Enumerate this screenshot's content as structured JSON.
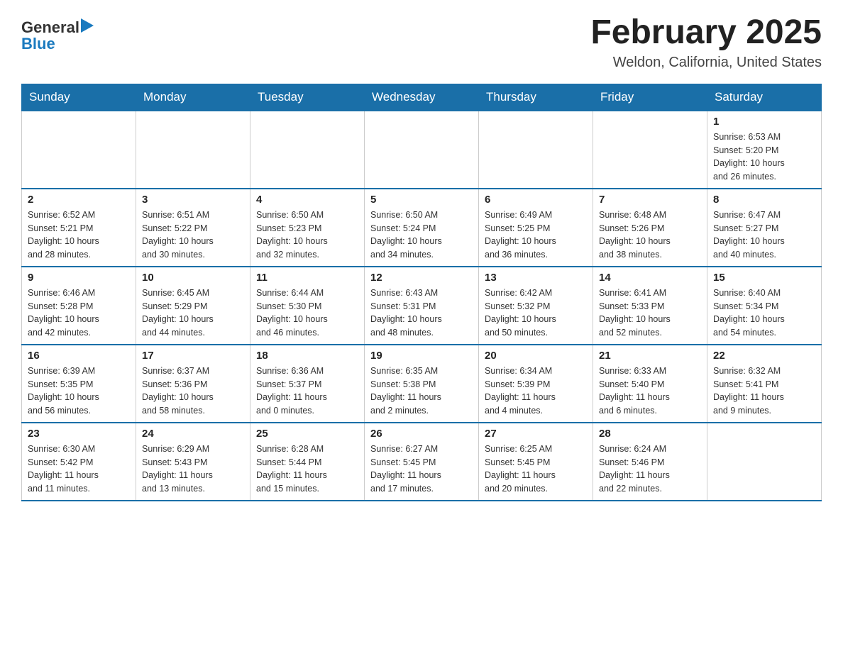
{
  "header": {
    "logo_general": "General",
    "logo_blue": "Blue",
    "month_title": "February 2025",
    "location": "Weldon, California, United States"
  },
  "days_of_week": [
    "Sunday",
    "Monday",
    "Tuesday",
    "Wednesday",
    "Thursday",
    "Friday",
    "Saturday"
  ],
  "weeks": [
    [
      {
        "day": "",
        "info": "",
        "empty": true
      },
      {
        "day": "",
        "info": "",
        "empty": true
      },
      {
        "day": "",
        "info": "",
        "empty": true
      },
      {
        "day": "",
        "info": "",
        "empty": true
      },
      {
        "day": "",
        "info": "",
        "empty": true
      },
      {
        "day": "",
        "info": "",
        "empty": true
      },
      {
        "day": "1",
        "info": "Sunrise: 6:53 AM\nSunset: 5:20 PM\nDaylight: 10 hours\nand 26 minutes.",
        "empty": false
      }
    ],
    [
      {
        "day": "2",
        "info": "Sunrise: 6:52 AM\nSunset: 5:21 PM\nDaylight: 10 hours\nand 28 minutes.",
        "empty": false
      },
      {
        "day": "3",
        "info": "Sunrise: 6:51 AM\nSunset: 5:22 PM\nDaylight: 10 hours\nand 30 minutes.",
        "empty": false
      },
      {
        "day": "4",
        "info": "Sunrise: 6:50 AM\nSunset: 5:23 PM\nDaylight: 10 hours\nand 32 minutes.",
        "empty": false
      },
      {
        "day": "5",
        "info": "Sunrise: 6:50 AM\nSunset: 5:24 PM\nDaylight: 10 hours\nand 34 minutes.",
        "empty": false
      },
      {
        "day": "6",
        "info": "Sunrise: 6:49 AM\nSunset: 5:25 PM\nDaylight: 10 hours\nand 36 minutes.",
        "empty": false
      },
      {
        "day": "7",
        "info": "Sunrise: 6:48 AM\nSunset: 5:26 PM\nDaylight: 10 hours\nand 38 minutes.",
        "empty": false
      },
      {
        "day": "8",
        "info": "Sunrise: 6:47 AM\nSunset: 5:27 PM\nDaylight: 10 hours\nand 40 minutes.",
        "empty": false
      }
    ],
    [
      {
        "day": "9",
        "info": "Sunrise: 6:46 AM\nSunset: 5:28 PM\nDaylight: 10 hours\nand 42 minutes.",
        "empty": false
      },
      {
        "day": "10",
        "info": "Sunrise: 6:45 AM\nSunset: 5:29 PM\nDaylight: 10 hours\nand 44 minutes.",
        "empty": false
      },
      {
        "day": "11",
        "info": "Sunrise: 6:44 AM\nSunset: 5:30 PM\nDaylight: 10 hours\nand 46 minutes.",
        "empty": false
      },
      {
        "day": "12",
        "info": "Sunrise: 6:43 AM\nSunset: 5:31 PM\nDaylight: 10 hours\nand 48 minutes.",
        "empty": false
      },
      {
        "day": "13",
        "info": "Sunrise: 6:42 AM\nSunset: 5:32 PM\nDaylight: 10 hours\nand 50 minutes.",
        "empty": false
      },
      {
        "day": "14",
        "info": "Sunrise: 6:41 AM\nSunset: 5:33 PM\nDaylight: 10 hours\nand 52 minutes.",
        "empty": false
      },
      {
        "day": "15",
        "info": "Sunrise: 6:40 AM\nSunset: 5:34 PM\nDaylight: 10 hours\nand 54 minutes.",
        "empty": false
      }
    ],
    [
      {
        "day": "16",
        "info": "Sunrise: 6:39 AM\nSunset: 5:35 PM\nDaylight: 10 hours\nand 56 minutes.",
        "empty": false
      },
      {
        "day": "17",
        "info": "Sunrise: 6:37 AM\nSunset: 5:36 PM\nDaylight: 10 hours\nand 58 minutes.",
        "empty": false
      },
      {
        "day": "18",
        "info": "Sunrise: 6:36 AM\nSunset: 5:37 PM\nDaylight: 11 hours\nand 0 minutes.",
        "empty": false
      },
      {
        "day": "19",
        "info": "Sunrise: 6:35 AM\nSunset: 5:38 PM\nDaylight: 11 hours\nand 2 minutes.",
        "empty": false
      },
      {
        "day": "20",
        "info": "Sunrise: 6:34 AM\nSunset: 5:39 PM\nDaylight: 11 hours\nand 4 minutes.",
        "empty": false
      },
      {
        "day": "21",
        "info": "Sunrise: 6:33 AM\nSunset: 5:40 PM\nDaylight: 11 hours\nand 6 minutes.",
        "empty": false
      },
      {
        "day": "22",
        "info": "Sunrise: 6:32 AM\nSunset: 5:41 PM\nDaylight: 11 hours\nand 9 minutes.",
        "empty": false
      }
    ],
    [
      {
        "day": "23",
        "info": "Sunrise: 6:30 AM\nSunset: 5:42 PM\nDaylight: 11 hours\nand 11 minutes.",
        "empty": false
      },
      {
        "day": "24",
        "info": "Sunrise: 6:29 AM\nSunset: 5:43 PM\nDaylight: 11 hours\nand 13 minutes.",
        "empty": false
      },
      {
        "day": "25",
        "info": "Sunrise: 6:28 AM\nSunset: 5:44 PM\nDaylight: 11 hours\nand 15 minutes.",
        "empty": false
      },
      {
        "day": "26",
        "info": "Sunrise: 6:27 AM\nSunset: 5:45 PM\nDaylight: 11 hours\nand 17 minutes.",
        "empty": false
      },
      {
        "day": "27",
        "info": "Sunrise: 6:25 AM\nSunset: 5:45 PM\nDaylight: 11 hours\nand 20 minutes.",
        "empty": false
      },
      {
        "day": "28",
        "info": "Sunrise: 6:24 AM\nSunset: 5:46 PM\nDaylight: 11 hours\nand 22 minutes.",
        "empty": false
      },
      {
        "day": "",
        "info": "",
        "empty": true
      }
    ]
  ]
}
